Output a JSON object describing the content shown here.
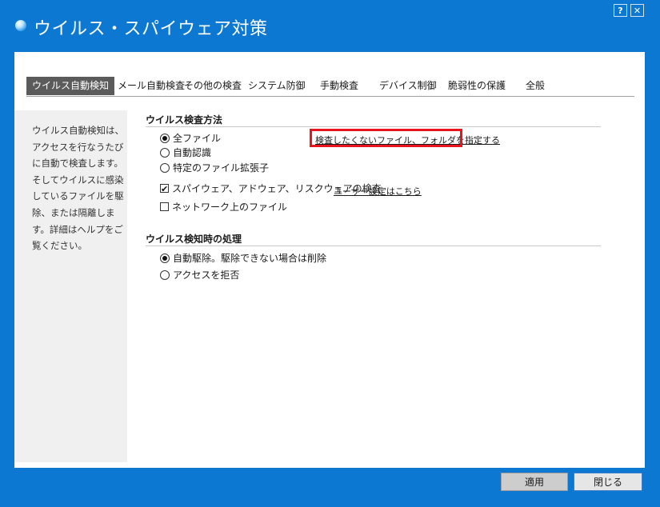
{
  "window": {
    "title": "ウイルス・スパイウェア対策",
    "help_label": "?",
    "close_label": "✕"
  },
  "tabs": [
    {
      "label": "ウイルス自動検知",
      "active": true
    },
    {
      "label": "メール自動検査",
      "active": false
    },
    {
      "label": "その他の検査",
      "active": false
    },
    {
      "label": "システム防御",
      "active": false
    },
    {
      "label": "手動検査",
      "active": false
    },
    {
      "label": "デバイス制御",
      "active": false
    },
    {
      "label": "脆弱性の保護",
      "active": false
    },
    {
      "label": "全般",
      "active": false
    }
  ],
  "description": "ウイルス自動検知は、アクセスを行なうたびに自動で検査します。そしてウイルスに感染しているファイルを駆除、または隔離します。詳細はヘルプをご覧ください。",
  "scan_method": {
    "heading": "ウイルス検査方法",
    "options": [
      {
        "label": "全ファイル",
        "selected": true
      },
      {
        "label": "自動認識",
        "selected": false
      },
      {
        "label": "特定のファイル拡張子",
        "selected": false
      }
    ],
    "exclude_link": "検査したくないファイル、フォルダを指定する",
    "spyware_check": {
      "label": "スパイウェア、アドウェア、リスクウェアの検査",
      "checked": true
    },
    "user_settings_link": "ユーザー設定はこちら",
    "network_check": {
      "label": "ネットワーク上のファイル",
      "checked": false
    }
  },
  "detect_action": {
    "heading": "ウイルス検知時の処理",
    "options": [
      {
        "label": "自動駆除。駆除できない場合は削除",
        "selected": true
      },
      {
        "label": "アクセスを拒否",
        "selected": false
      }
    ]
  },
  "footer": {
    "apply_label": "適用",
    "close_label": "閉じる"
  },
  "colors": {
    "frame": "#0c78d2",
    "active_tab": "#5b5b5b",
    "highlight": "#e8141e"
  }
}
